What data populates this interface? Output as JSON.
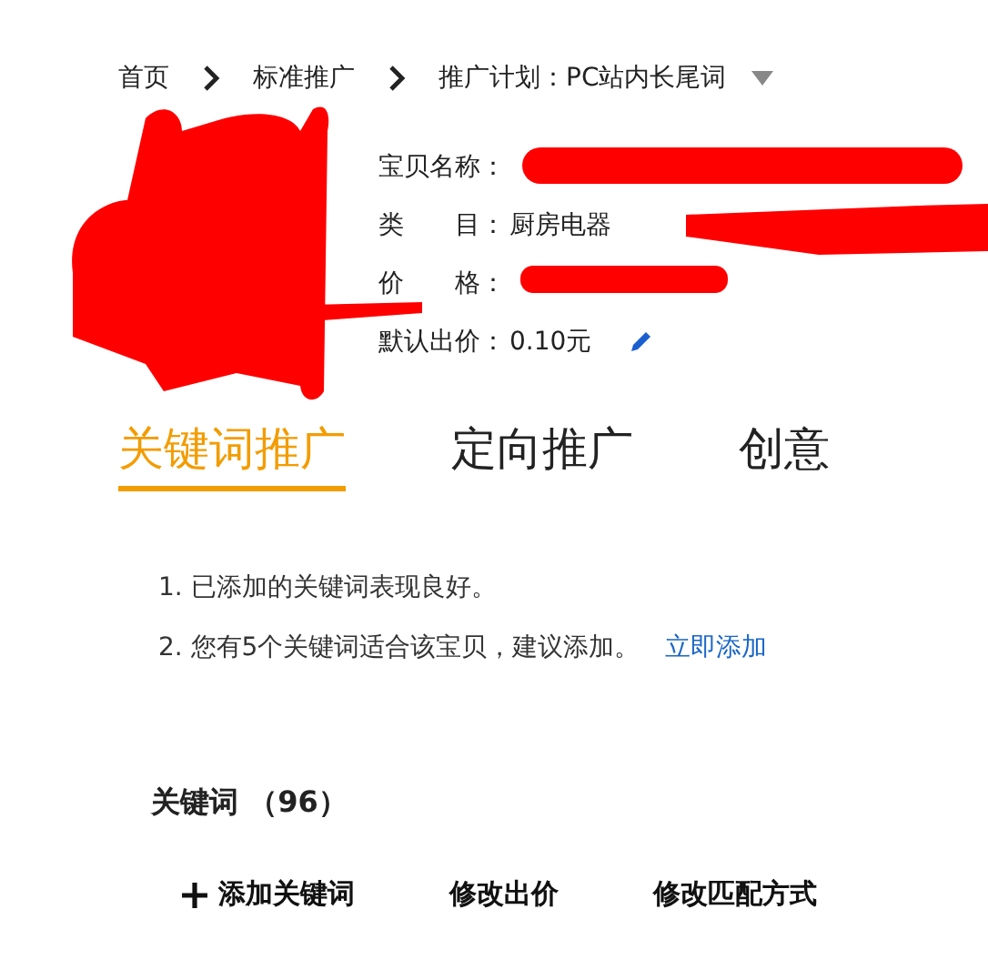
{
  "breadcrumb": [
    {
      "label": "首页",
      "dropdown": false
    },
    {
      "label": "标准推广",
      "dropdown": false
    },
    {
      "label": "推广计划：PC站内长尾词",
      "dropdown": true
    }
  ],
  "item": {
    "fields": [
      {
        "label": "宝贝名称：",
        "editable": false
      },
      {
        "label": "类　　目：",
        "value": "厨房电器",
        "editable": false
      },
      {
        "label": "价　　格：",
        "editable": false
      },
      {
        "label": "默认出价：",
        "value": "0.10元",
        "editable": true
      }
    ]
  },
  "tabs": [
    {
      "label": "关键词推广",
      "selected": true
    },
    {
      "label": "定向推广",
      "selected": false
    },
    {
      "label": "创意",
      "selected": false
    }
  ],
  "tips": [
    {
      "text": "1. 已添加的关键词表现良好。"
    },
    {
      "text": "2. 您有5个关键词适合该宝贝，建议添加。",
      "link": "立即添加"
    }
  ],
  "keywords": {
    "title": "关键词 （96）"
  },
  "actions": [
    {
      "label": "添加关键词",
      "kind": "add"
    },
    {
      "label": "修改出价",
      "kind": "plain"
    },
    {
      "label": "修改匹配方式",
      "kind": "plain"
    }
  ]
}
